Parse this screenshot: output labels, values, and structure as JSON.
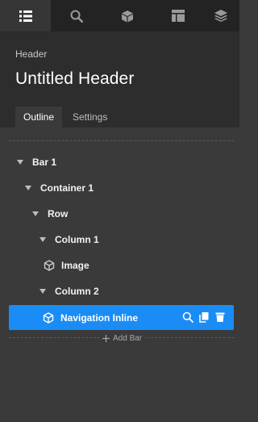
{
  "toolbar": {
    "tabs": [
      {
        "icon": "list-icon",
        "active": true
      },
      {
        "icon": "search-icon",
        "active": false
      },
      {
        "icon": "cube-icon",
        "active": false
      },
      {
        "icon": "layout-icon",
        "active": false
      },
      {
        "icon": "layers-icon",
        "active": false
      }
    ]
  },
  "header": {
    "breadcrumb": "Header",
    "title": "Untitled Header"
  },
  "panel_tabs": {
    "outline": "Outline",
    "settings": "Settings",
    "active": "outline"
  },
  "tree": {
    "items": [
      {
        "label": "Bar 1",
        "type": "caret"
      },
      {
        "label": "Container 1",
        "type": "caret"
      },
      {
        "label": "Row",
        "type": "caret"
      },
      {
        "label": "Column 1",
        "type": "caret"
      },
      {
        "label": "Image",
        "type": "element"
      },
      {
        "label": "Column 2",
        "type": "caret"
      },
      {
        "label": "Navigation Inline",
        "type": "element",
        "selected": true
      }
    ]
  },
  "add_bar": {
    "label": "Add Bar"
  },
  "colors": {
    "accent": "#1a8cf5",
    "panel_bg": "#3a3a3a",
    "toolbar_bg": "#232323",
    "header_bg": "#2d2d2d"
  }
}
